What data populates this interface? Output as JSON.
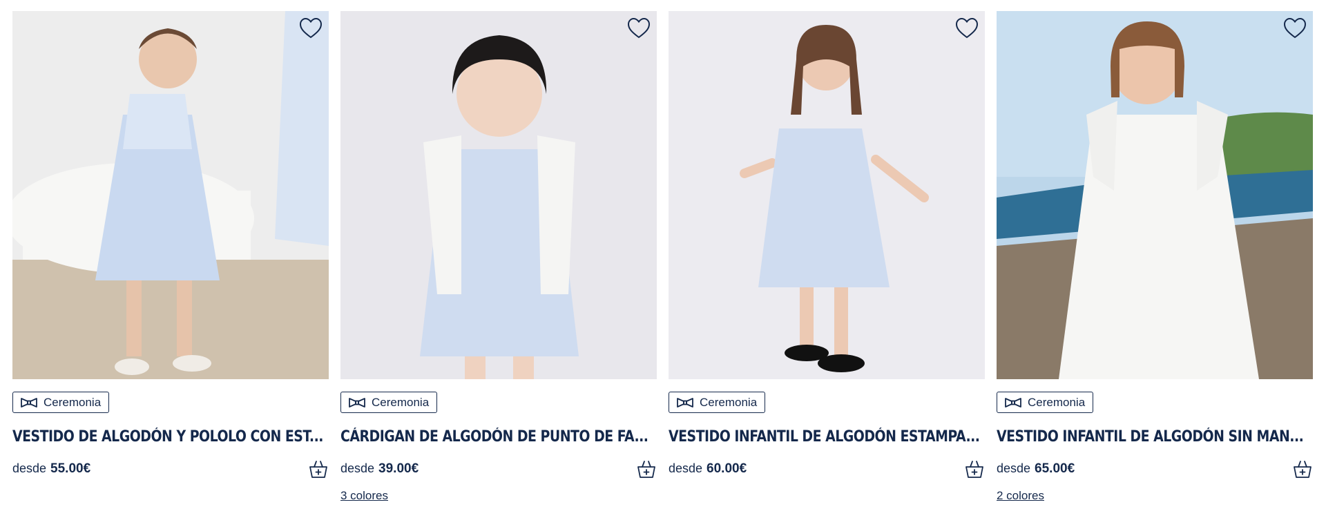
{
  "products": [
    {
      "badge": "Ceremonia",
      "title": "VESTIDO DE ALGODÓN Y POLOLO CON EST...",
      "price_prefix": "desde",
      "price": "55.00€",
      "colors": ""
    },
    {
      "badge": "Ceremonia",
      "title": "CÁRDIGAN DE ALGODÓN DE PUNTO DE FA...",
      "price_prefix": "desde",
      "price": "39.00€",
      "colors": "3 colores"
    },
    {
      "badge": "Ceremonia",
      "title": "VESTIDO INFANTIL DE ALGODÓN ESTAMPA...",
      "price_prefix": "desde",
      "price": "60.00€",
      "colors": ""
    },
    {
      "badge": "Ceremonia",
      "title": "VESTIDO INFANTIL DE ALGODÓN SIN MAN...",
      "price_prefix": "desde",
      "price": "65.00€",
      "colors": "2 colores"
    }
  ],
  "icons": {
    "favorite": "heart-outline-icon",
    "badge": "bow-tie-icon",
    "cart": "shopping-basket-add-icon"
  },
  "colors": {
    "text": "#14284b",
    "background": "#ffffff"
  }
}
